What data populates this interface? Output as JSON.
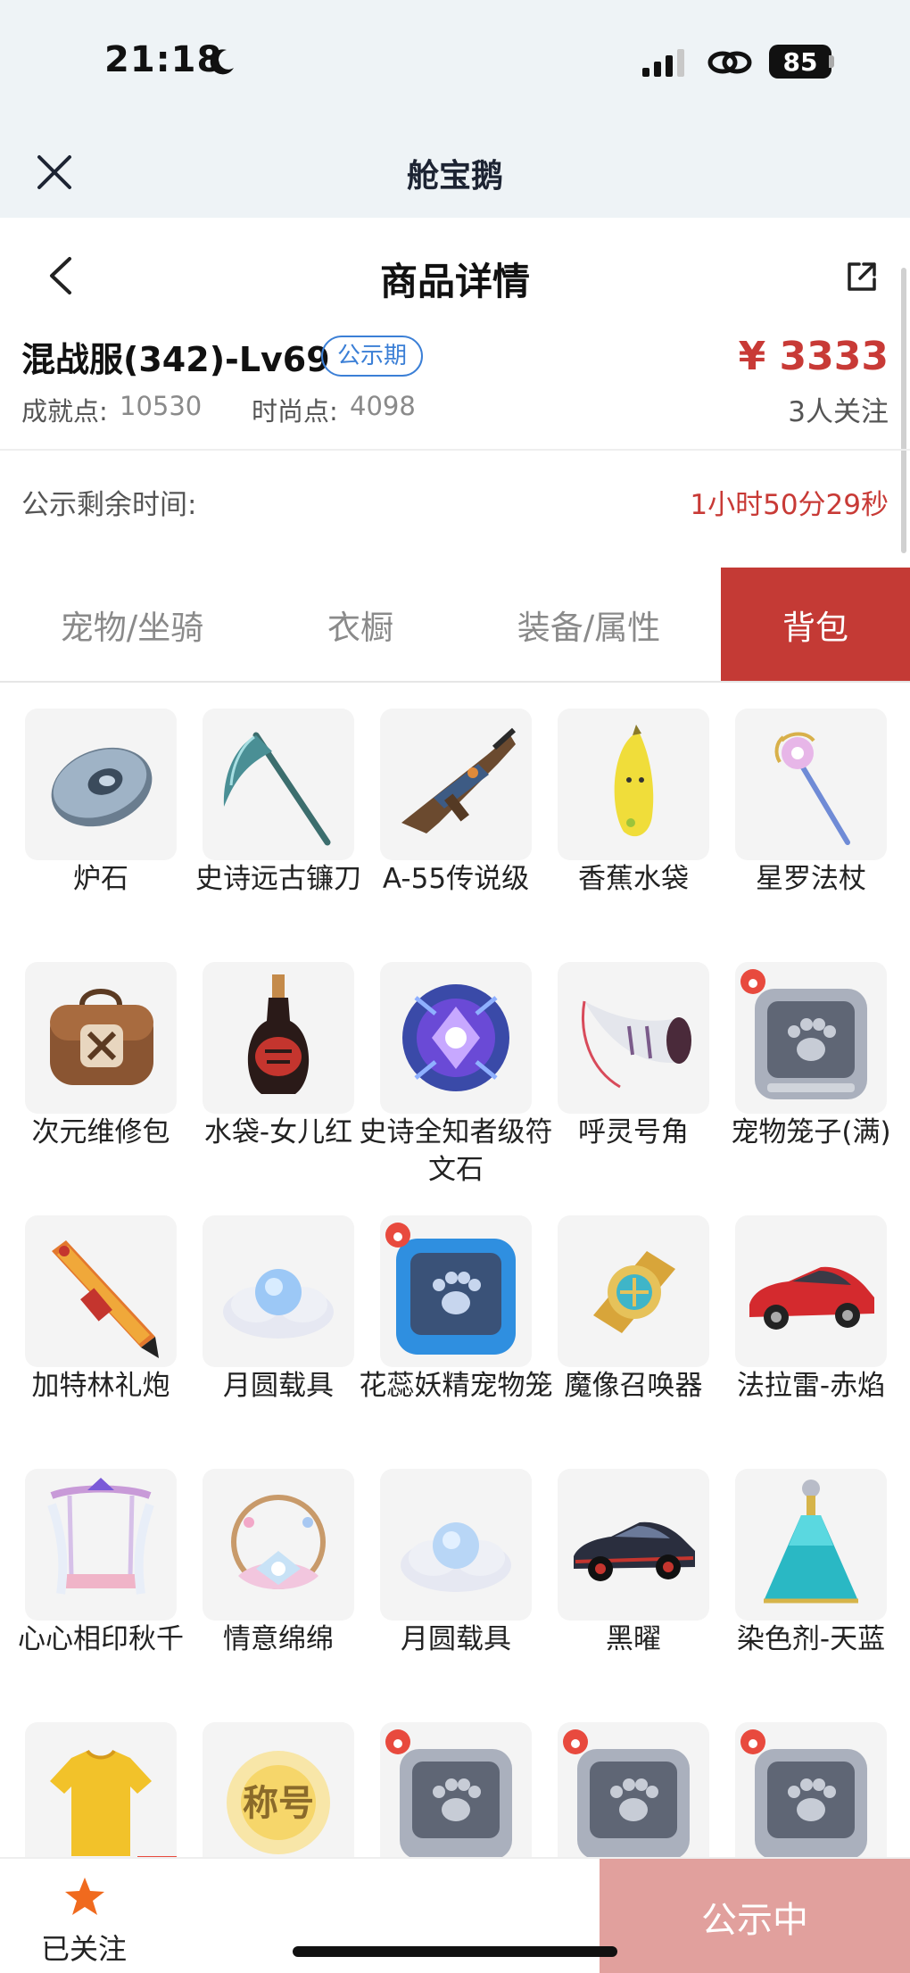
{
  "status_bar": {
    "time": "21:18",
    "battery": "85"
  },
  "nav": {
    "title": "舱宝鹅"
  },
  "header": {
    "title": "商品详情"
  },
  "product": {
    "name": "混战服(342)-Lv69",
    "badge": "公示期",
    "price": "¥ 3333",
    "achievement_label": "成就点:",
    "achievement_value": "10530",
    "fashion_label": "时尚点:",
    "fashion_value": "4098",
    "watchers": "3人关注"
  },
  "countdown": {
    "label": "公示剩余时间:",
    "value": "1小时50分29秒"
  },
  "tabs": [
    {
      "label": "宠物/坐骑"
    },
    {
      "label": "衣橱"
    },
    {
      "label": "装备/属性"
    },
    {
      "label": "背包"
    }
  ],
  "items": [
    {
      "label": "炉石",
      "icon": "hearthstone-icon"
    },
    {
      "label": "史诗远古镰刀",
      "icon": "scythe-icon"
    },
    {
      "label": "A-55传说级",
      "icon": "rifle-icon"
    },
    {
      "label": "香蕉水袋",
      "icon": "banana-icon"
    },
    {
      "label": "星罗法杖",
      "icon": "staff-icon"
    },
    {
      "label": "次元维修包",
      "icon": "repair-bag-icon"
    },
    {
      "label": "水袋-女儿红",
      "icon": "wine-bottle-icon"
    },
    {
      "label": "史诗全知者级符文石",
      "icon": "rune-stone-icon"
    },
    {
      "label": "呼灵号角",
      "icon": "horn-icon"
    },
    {
      "label": "宠物笼子(满)",
      "icon": "pet-cage-icon"
    },
    {
      "label": "加特林礼炮",
      "icon": "gatling-cannon-icon"
    },
    {
      "label": "月圆载具",
      "icon": "moon-vehicle-icon"
    },
    {
      "label": "花蕊妖精宠物笼",
      "icon": "blue-pet-cage-icon"
    },
    {
      "label": "魔像召唤器",
      "icon": "golem-summoner-icon"
    },
    {
      "label": "法拉雷-赤焰",
      "icon": "red-car-icon"
    },
    {
      "label": "心心相印秋千",
      "icon": "swing-icon"
    },
    {
      "label": "情意绵绵",
      "icon": "wreath-icon"
    },
    {
      "label": "月圆载具",
      "icon": "moon-vehicle-icon"
    },
    {
      "label": "黑曜",
      "icon": "black-car-icon"
    },
    {
      "label": "染色剂-天蓝",
      "icon": "dye-bottle-icon"
    },
    {
      "label": "",
      "icon": "shirt-icon"
    },
    {
      "label": "",
      "icon": "title-badge-icon",
      "text": "称号"
    },
    {
      "label": "",
      "icon": "pet-cage-icon"
    },
    {
      "label": "",
      "icon": "pet-cage-icon"
    },
    {
      "label": "",
      "icon": "pet-cage-icon"
    }
  ],
  "bottom": {
    "follow_label": "已关注",
    "public_label": "公示中"
  },
  "colors": {
    "accent": "#c43a35",
    "badge_blue": "#3b7fd6",
    "button_disabled": "#e1a09d"
  }
}
